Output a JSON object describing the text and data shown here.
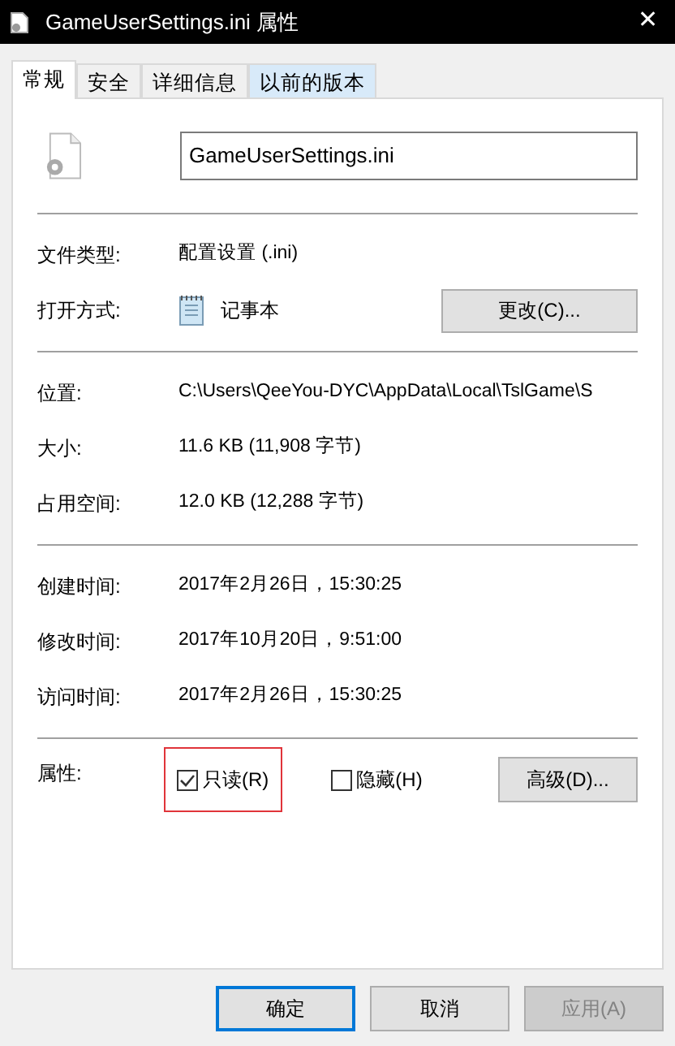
{
  "window": {
    "title": "GameUserSettings.ini 属性",
    "close": "✕"
  },
  "tabs": [
    {
      "label": "常规",
      "selected": true,
      "hovered": false
    },
    {
      "label": "安全",
      "selected": false,
      "hovered": false
    },
    {
      "label": "详细信息",
      "selected": false,
      "hovered": false
    },
    {
      "label": "以前的版本",
      "selected": false,
      "hovered": true
    }
  ],
  "file_name": "GameUserSettings.ini",
  "type_row": {
    "label": "文件类型:",
    "value": "配置设置 (.ini)"
  },
  "open_with": {
    "label": "打开方式:",
    "value": "记事本",
    "button": "更改(C)..."
  },
  "location_rows": [
    {
      "label": "位置:",
      "value": "C:\\Users\\QeeYou-DYC\\AppData\\Local\\TslGame\\S"
    },
    {
      "label": "大小:",
      "value": "11.6 KB (11,908 字节)"
    },
    {
      "label": "占用空间:",
      "value": "12.0 KB (12,288 字节)"
    }
  ],
  "time_rows": [
    {
      "label": "创建时间:",
      "value": "2017年2月26日，15:30:25"
    },
    {
      "label": "修改时间:",
      "value": "2017年10月20日，9:51:00"
    },
    {
      "label": "访问时间:",
      "value": "2017年2月26日，15:30:25"
    }
  ],
  "attributes": {
    "label": "属性:",
    "checkboxes": [
      {
        "label": "只读(R)",
        "checked": true,
        "highlighted": true
      },
      {
        "label": "隐藏(H)",
        "checked": false,
        "highlighted": false
      }
    ],
    "button": "高级(D)..."
  },
  "buttons": [
    {
      "label": "确定",
      "kind": "default",
      "disabled": false
    },
    {
      "label": "取消",
      "kind": "normal",
      "disabled": false
    },
    {
      "label": "应用(A)",
      "kind": "normal",
      "disabled": true
    }
  ]
}
